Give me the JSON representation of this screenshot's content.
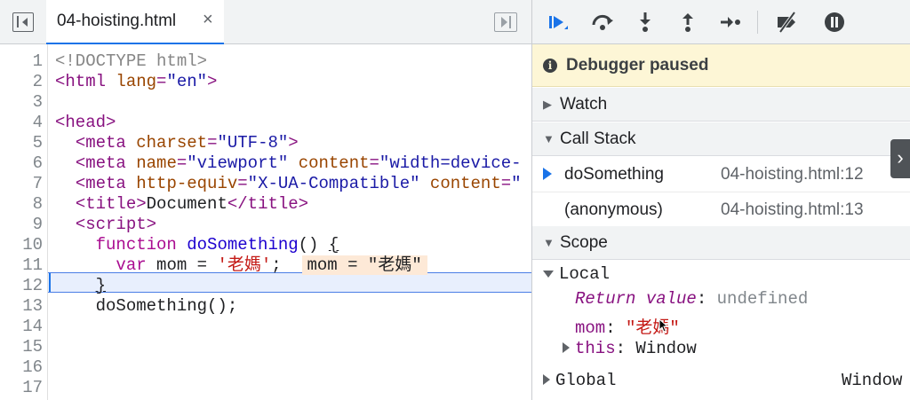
{
  "editor": {
    "tab_title": "04-hoisting.html",
    "tab_close": "×",
    "lines": [
      {
        "n": "1",
        "parts": [
          {
            "c": "comment",
            "t": "<!DOCTYPE html>"
          }
        ]
      },
      {
        "n": "2",
        "parts": [
          {
            "c": "tag",
            "t": "<html "
          },
          {
            "c": "attr",
            "t": "lang"
          },
          {
            "c": "tag",
            "t": "="
          },
          {
            "c": "val",
            "t": "\"en\""
          },
          {
            "c": "tag",
            "t": ">"
          }
        ]
      },
      {
        "n": "3",
        "parts": []
      },
      {
        "n": "4",
        "parts": [
          {
            "c": "tag",
            "t": "<head>"
          }
        ]
      },
      {
        "n": "5",
        "parts": [
          {
            "c": "plain",
            "t": "  "
          },
          {
            "c": "tag",
            "t": "<meta "
          },
          {
            "c": "attr",
            "t": "charset"
          },
          {
            "c": "tag",
            "t": "="
          },
          {
            "c": "val",
            "t": "\"UTF-8\""
          },
          {
            "c": "tag",
            "t": ">"
          }
        ]
      },
      {
        "n": "6",
        "parts": [
          {
            "c": "plain",
            "t": "  "
          },
          {
            "c": "tag",
            "t": "<meta "
          },
          {
            "c": "attr",
            "t": "name"
          },
          {
            "c": "tag",
            "t": "="
          },
          {
            "c": "val",
            "t": "\"viewport\""
          },
          {
            "c": "plain",
            "t": " "
          },
          {
            "c": "attr",
            "t": "content"
          },
          {
            "c": "tag",
            "t": "="
          },
          {
            "c": "val",
            "t": "\"width=device-"
          }
        ]
      },
      {
        "n": "7",
        "parts": [
          {
            "c": "plain",
            "t": "  "
          },
          {
            "c": "tag",
            "t": "<meta "
          },
          {
            "c": "attr",
            "t": "http-equiv"
          },
          {
            "c": "tag",
            "t": "="
          },
          {
            "c": "val",
            "t": "\"X-UA-Compatible\""
          },
          {
            "c": "plain",
            "t": " "
          },
          {
            "c": "attr",
            "t": "content"
          },
          {
            "c": "tag",
            "t": "="
          },
          {
            "c": "val",
            "t": "\""
          }
        ]
      },
      {
        "n": "8",
        "parts": [
          {
            "c": "plain",
            "t": "  "
          },
          {
            "c": "tag",
            "t": "<title>"
          },
          {
            "c": "plain",
            "t": "Document"
          },
          {
            "c": "tag",
            "t": "</title>"
          }
        ]
      },
      {
        "n": "9",
        "parts": [
          {
            "c": "plain",
            "t": "  "
          },
          {
            "c": "tag",
            "t": "<script>"
          }
        ]
      },
      {
        "n": "10",
        "parts": [
          {
            "c": "plain",
            "t": "    "
          },
          {
            "c": "kw",
            "t": "function"
          },
          {
            "c": "plain",
            "t": " "
          },
          {
            "c": "fn",
            "t": "doSomething"
          },
          {
            "c": "plain",
            "t": "() "
          },
          {
            "c": "plain ul",
            "t": "{"
          }
        ]
      },
      {
        "n": "11",
        "parts": [
          {
            "c": "plain",
            "t": "      "
          },
          {
            "c": "kw",
            "t": "var"
          },
          {
            "c": "plain",
            "t": " mom = "
          },
          {
            "c": "str",
            "t": "'老媽'"
          },
          {
            "c": "plain",
            "t": ";  "
          },
          {
            "c": "inline-val",
            "t": "mom = \"老媽\""
          }
        ]
      },
      {
        "n": "12",
        "parts": [
          {
            "c": "plain",
            "t": "    "
          },
          {
            "c": "plain ul",
            "t": "}"
          }
        ]
      },
      {
        "n": "13",
        "parts": [
          {
            "c": "plain",
            "t": "    doSomething();"
          }
        ]
      },
      {
        "n": "14",
        "parts": []
      },
      {
        "n": "15",
        "parts": []
      },
      {
        "n": "16",
        "parts": []
      },
      {
        "n": "17",
        "parts": []
      }
    ]
  },
  "debugger": {
    "paused_text": "Debugger paused",
    "info_icon": "i",
    "watch_label": "Watch",
    "call_stack_label": "Call Stack",
    "frames": [
      {
        "name": "doSomething",
        "location": "04-hoisting.html:12"
      },
      {
        "name": "(anonymous)",
        "location": "04-hoisting.html:13"
      }
    ],
    "scope_label": "Scope",
    "local_label": "Local",
    "return_key": "Return value",
    "return_value": "undefined",
    "mom_key": "mom",
    "mom_value": "\"老媽\"",
    "this_key": "this",
    "this_value": "Window",
    "global_label": "Global",
    "global_value": "Window",
    "expand_glyph": "›"
  },
  "colors": {
    "accent": "#1a73e8",
    "banner": "#fdf6d6",
    "string": "#c41a16",
    "tag": "#881280"
  }
}
